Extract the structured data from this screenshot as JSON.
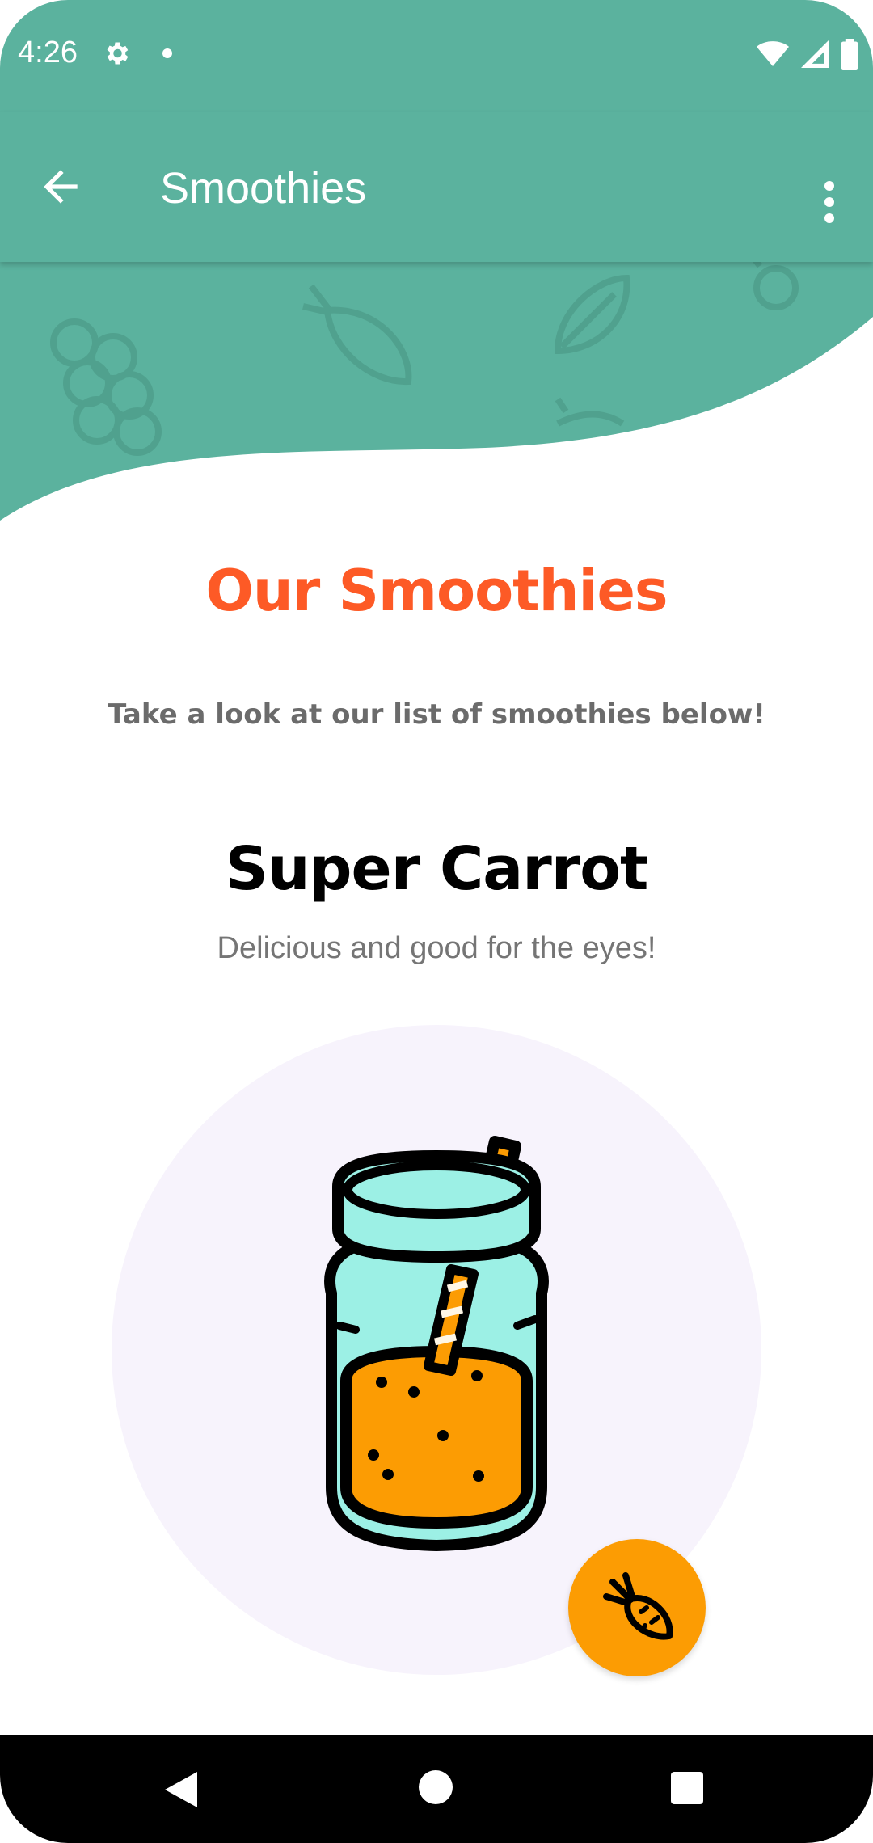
{
  "status_bar": {
    "time": "4:26",
    "icons": [
      "gear-icon",
      "notification-dot-icon",
      "wifi-icon",
      "cell-signal-icon",
      "battery-icon"
    ]
  },
  "app_bar": {
    "title": "Smoothies",
    "back_icon": "arrow-left-icon",
    "menu_icon": "more-vertical-icon"
  },
  "content": {
    "section_title": "Our Smoothies",
    "section_subtitle": "Take a look at our list of smoothies below!",
    "smoothie": {
      "name": "Super Carrot",
      "description": "Delicious and good for the eyes!",
      "image_icon": "smoothie-jar-icon",
      "fab_icon": "carrot-icon"
    }
  },
  "colors": {
    "primary": "#5bb29e",
    "accent": "#fd5a26",
    "fab": "#fc9c03",
    "image_background": "#f7f3fc"
  },
  "nav_bar": {
    "icons": [
      "nav-back-icon",
      "nav-home-icon",
      "nav-recents-icon"
    ]
  }
}
